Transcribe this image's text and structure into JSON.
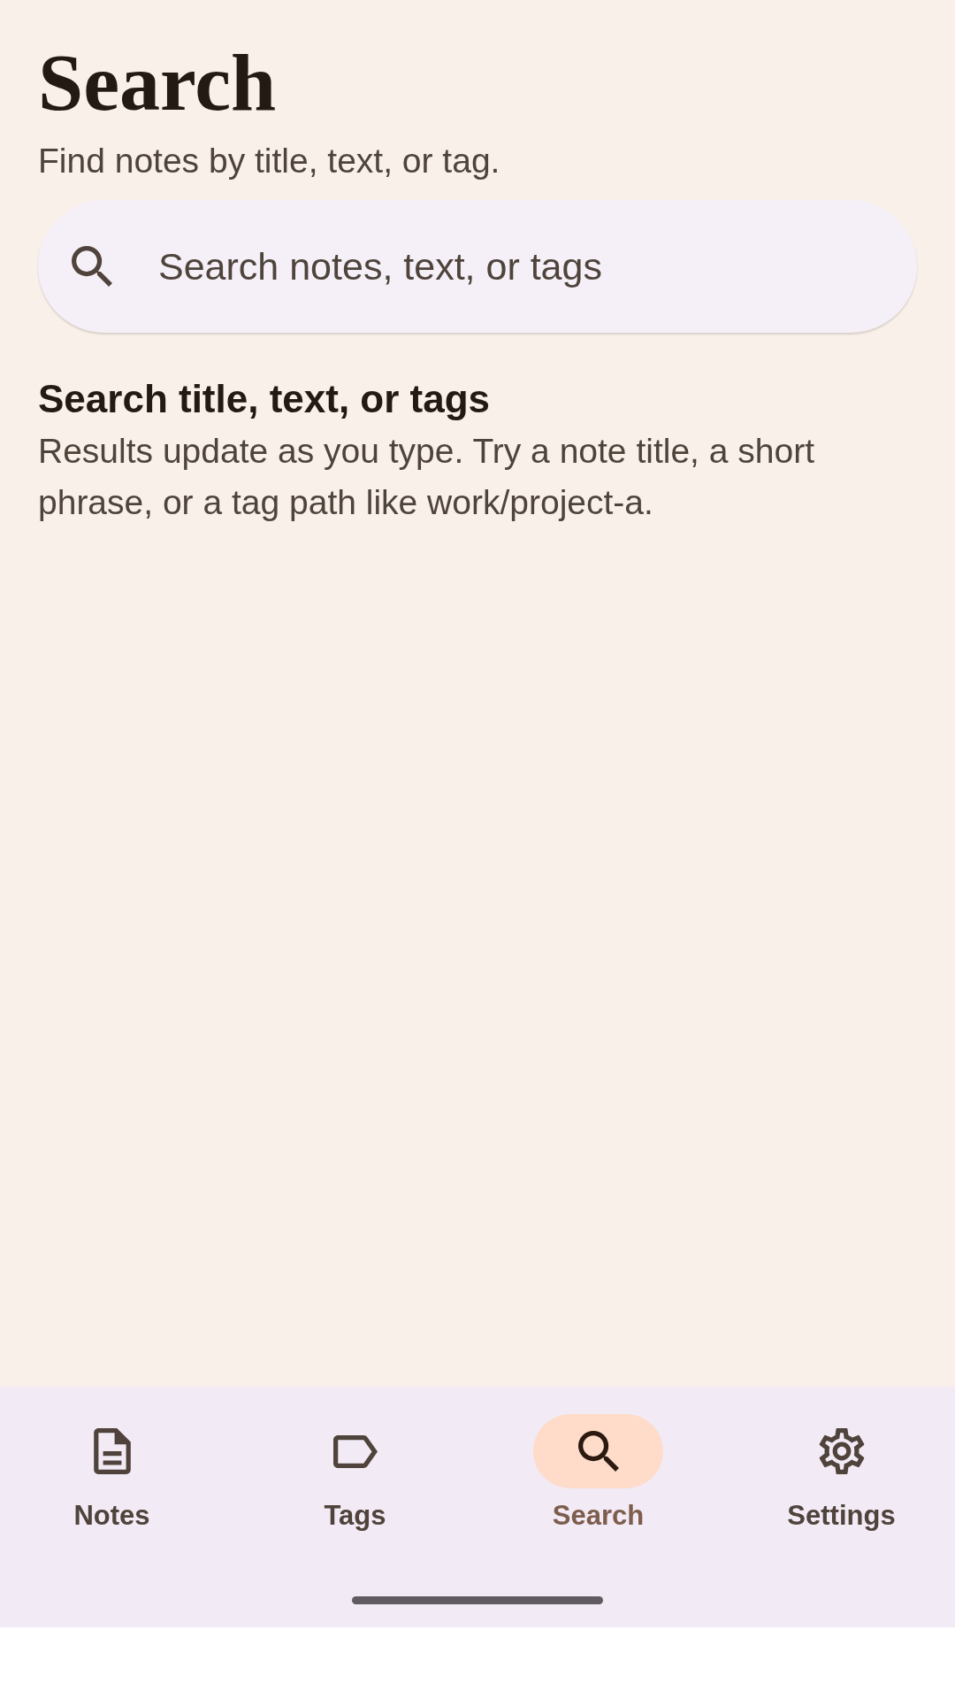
{
  "header": {
    "title": "Search",
    "subtitle": "Find notes by title, text, or tag."
  },
  "search": {
    "placeholder": "Search notes, text, or tags"
  },
  "empty_state": {
    "heading": "Search title, text, or tags",
    "body": "Results update as you type. Try a note title, a short phrase, or a tag path like work/project-a."
  },
  "nav": {
    "items": [
      {
        "kind": "notes",
        "label": "Notes",
        "selected": false
      },
      {
        "kind": "tags",
        "label": "Tags",
        "selected": false
      },
      {
        "kind": "search",
        "label": "Search",
        "selected": true
      },
      {
        "kind": "settings",
        "label": "Settings",
        "selected": false
      }
    ]
  }
}
